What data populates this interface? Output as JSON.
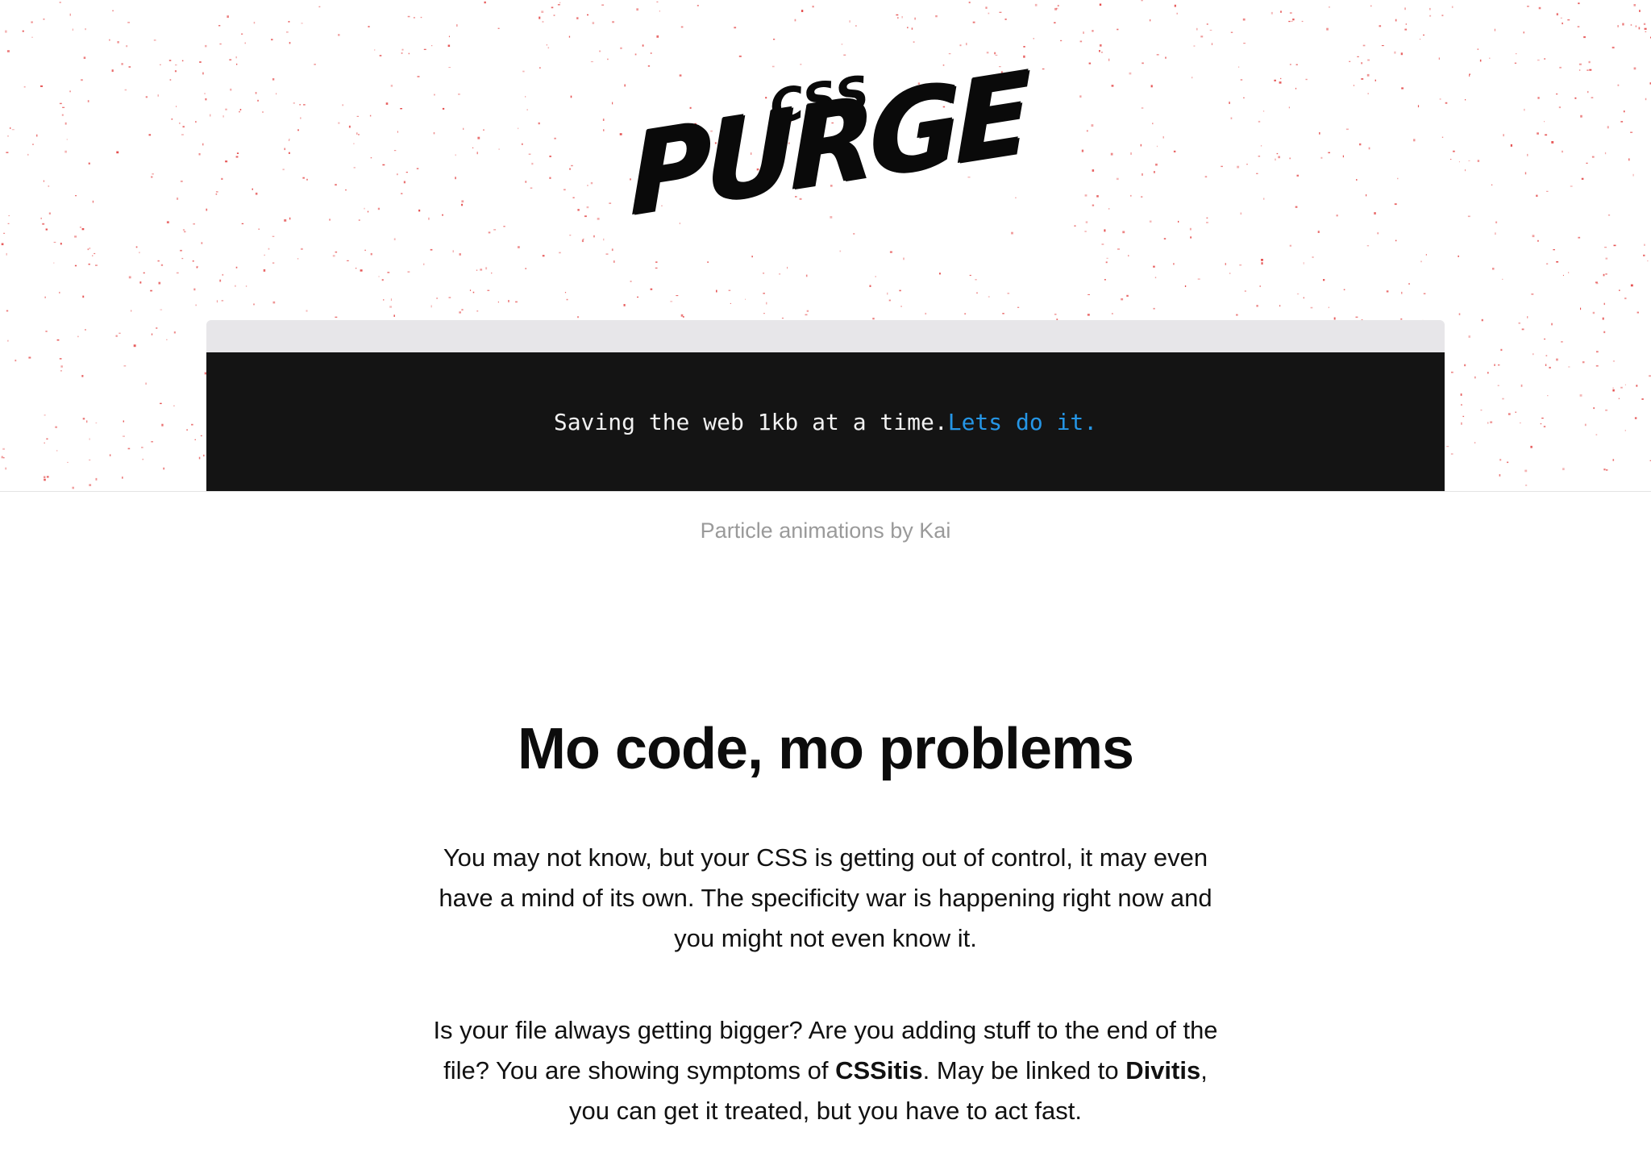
{
  "hero": {
    "logo": {
      "small_word": "CSS",
      "big_word": "PURGE"
    },
    "terminal": {
      "message": "Saving the web 1kb at a time.",
      "cta": "Lets do it."
    },
    "particle_color": "#e23b3b"
  },
  "credit": "Particle animations by Kai",
  "main": {
    "heading": "Mo code, mo problems",
    "paragraph1": "You may not know, but your CSS is getting out of control, it may even have a mind of its own. The specificity war is happening right now and you might not even know it.",
    "paragraph2": {
      "part1": "Is your file always getting bigger? Are you adding stuff to the end of the file? You are showing symptoms of ",
      "bold1": "CSSitis",
      "part2": ". May be linked to ",
      "bold2": "Divitis",
      "part3": ", you can get it treated, but you have to act fast."
    }
  },
  "colors": {
    "terminal_bg": "#141414",
    "terminal_bar": "#e7e6e9",
    "cta": "#2596e6",
    "credit": "#9a9a9a"
  }
}
